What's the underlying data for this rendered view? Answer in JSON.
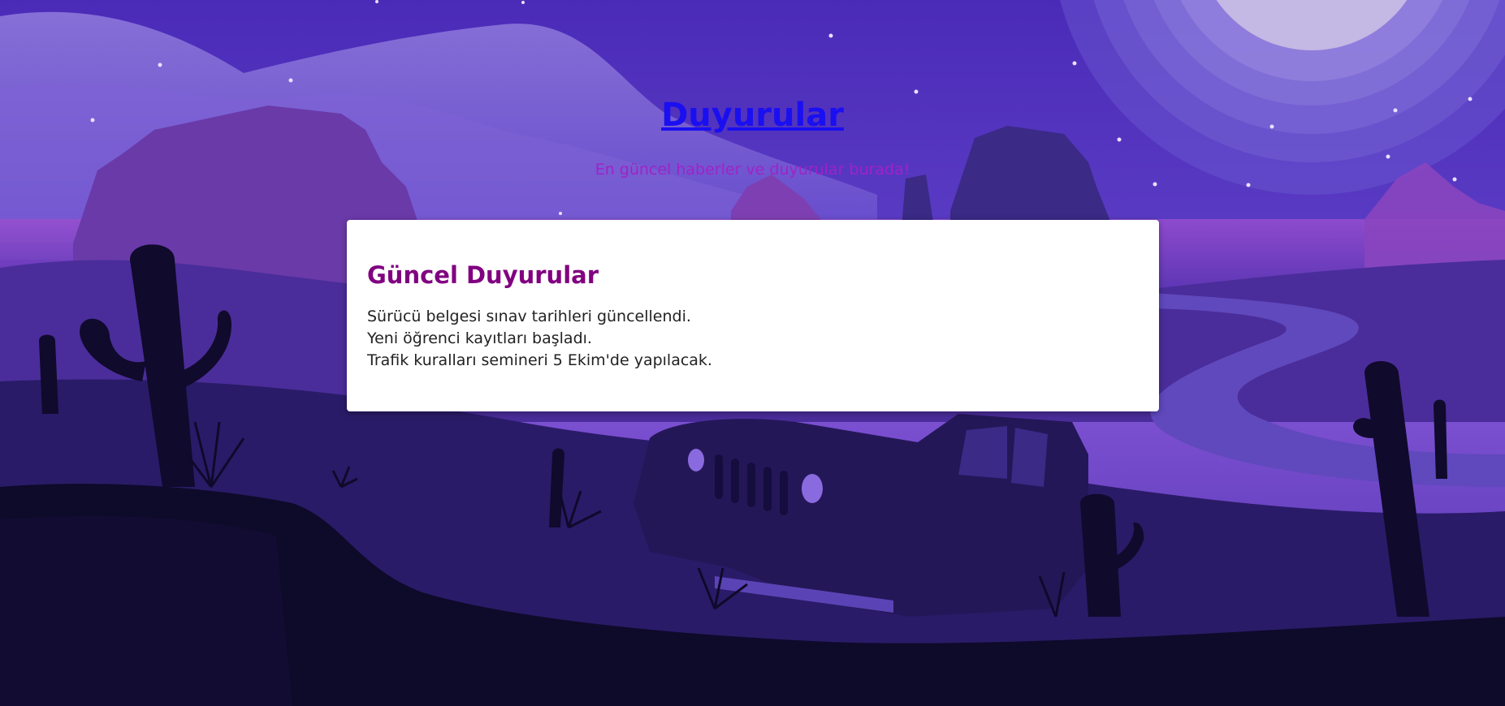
{
  "header": {
    "title": "Duyurular",
    "subtitle": "En güncel haberler ve duyurular burada!"
  },
  "announcements": {
    "heading": "Güncel Duyurular",
    "items": [
      "Sürücü belgesi sınav tarihleri güncellendi.",
      "Yeni öğrenci kayıtları başladı.",
      "Trafik kuralları semineri 5 Ekim'de yapılacak."
    ]
  },
  "colors": {
    "title_link": "#1a0ff0",
    "subtitle": "#a022c8",
    "heading": "#800080",
    "sky_top": "#4a2bb8",
    "ground_dark": "#0e0a2a"
  },
  "background": {
    "icons": [
      "moon-icon",
      "cactus-icon",
      "jeep-icon",
      "mesa-icon",
      "stars-icon"
    ]
  }
}
